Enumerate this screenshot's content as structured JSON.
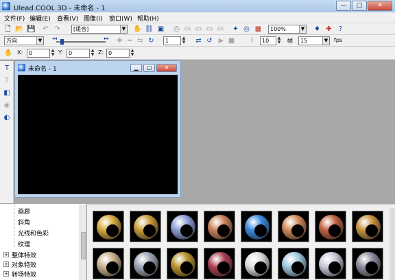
{
  "window": {
    "title": "Ulead COOL 3D - 未命名 - 1",
    "minimize": "—",
    "maximize": "□",
    "close": "✕"
  },
  "menu": [
    "文件(F)",
    "编辑(E)",
    "查看(V)",
    "图像(I)",
    "窗口(W)",
    "帮助(H)"
  ],
  "toolbar1": {
    "object_select": "[组合]",
    "zoom_select": "100%"
  },
  "toolbar2": {
    "direction_select": "方向",
    "frame_value": "1",
    "speed_value": "10",
    "frame_label": "帧",
    "frames_select": "15",
    "fps_label": "fps"
  },
  "toolbar3": {
    "x_label": "X:",
    "x_value": "0",
    "y_label": "Y:",
    "y_value": "0",
    "z_label": "Z:",
    "z_value": "0"
  },
  "document": {
    "title": "未命名 - 1"
  },
  "tree": {
    "items": [
      {
        "label": "画廊",
        "indent": 2
      },
      {
        "label": "斜角",
        "indent": 2
      },
      {
        "label": "光线和色彩",
        "indent": 2
      },
      {
        "label": "纹理",
        "indent": 2
      },
      {
        "label": "整体特效",
        "indent": 0,
        "expander": "+"
      },
      {
        "label": "对象特效",
        "indent": 0,
        "expander": "+"
      },
      {
        "label": "转场特效",
        "indent": 0,
        "expander": "+"
      }
    ]
  },
  "gallery": {
    "thumbnails": [
      {
        "name": "gold-ring",
        "color": "#d4a93a"
      },
      {
        "name": "brass-ring",
        "color": "#c99a3a"
      },
      {
        "name": "silver-shine-ring",
        "color": "#8c9fd8"
      },
      {
        "name": "copper-ring",
        "color": "#c9805a"
      },
      {
        "name": "blue-marble-ring",
        "color": "#3a8ae0"
      },
      {
        "name": "copper-bead-ring",
        "color": "#d08a5a"
      },
      {
        "name": "rust-bead-ring",
        "color": "#c06040"
      },
      {
        "name": "amber-bead-ring",
        "color": "#c99040"
      },
      {
        "name": "cream-weave-ring",
        "color": "#c8b08a"
      },
      {
        "name": "steel-grid-ring",
        "color": "#9aa4b4"
      },
      {
        "name": "gold-dots-ring",
        "color": "#b8902a"
      },
      {
        "name": "stained-glass-ring",
        "color": "#a84050"
      },
      {
        "name": "pearl-ring",
        "color": "#dcdcdc"
      },
      {
        "name": "ice-ring",
        "color": "#a0c8e0"
      },
      {
        "name": "chrome-ring",
        "color": "#c8c8d8"
      },
      {
        "name": "pewter-dots-ring",
        "color": "#8a8a9a"
      }
    ]
  }
}
